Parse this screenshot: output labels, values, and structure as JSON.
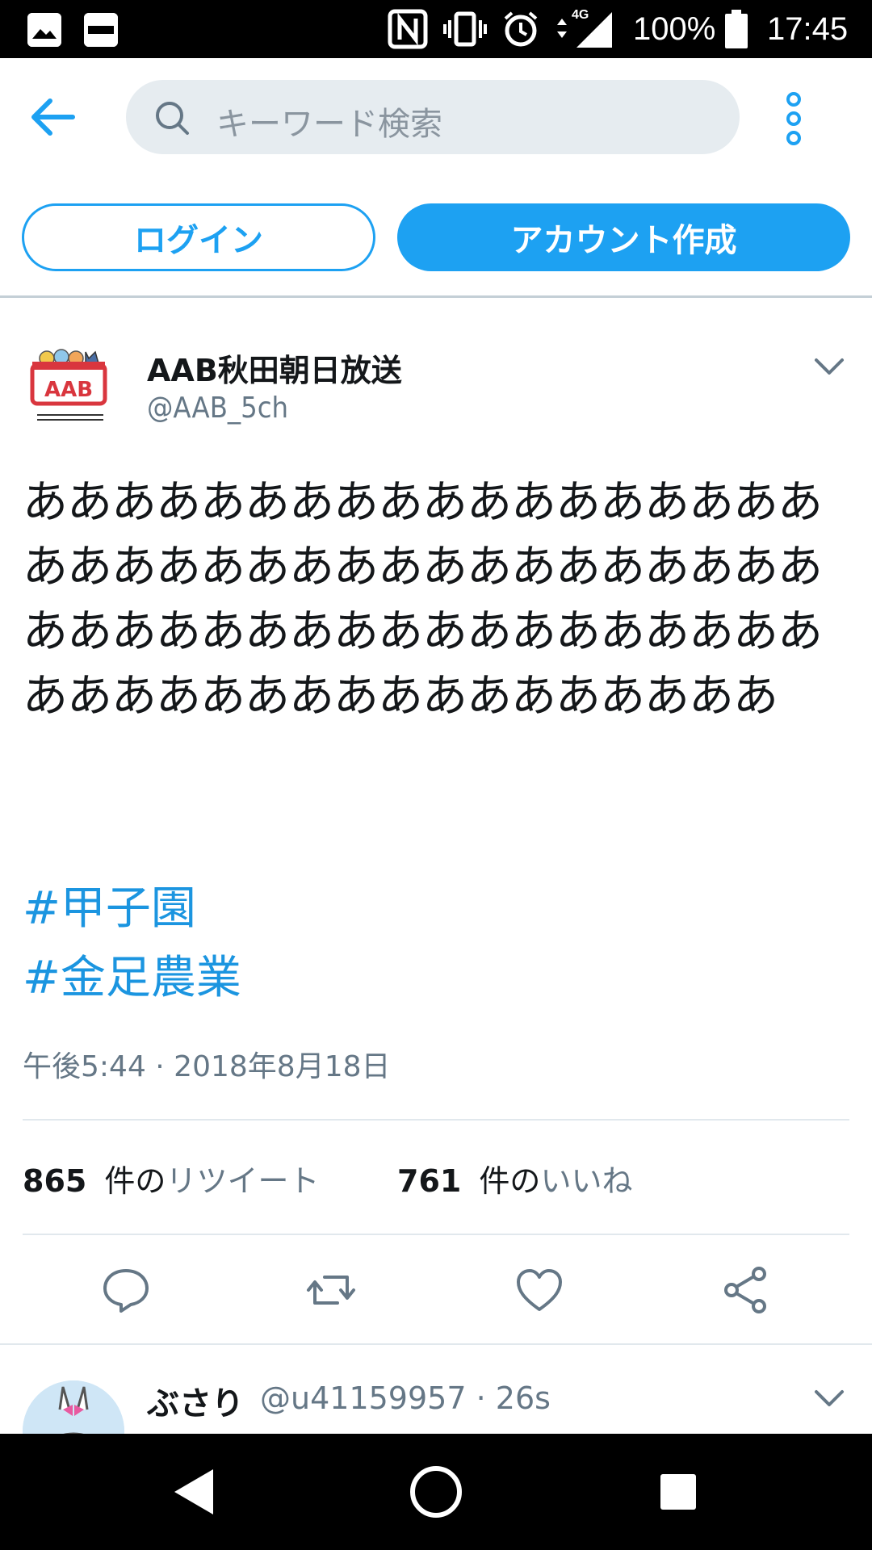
{
  "status_bar": {
    "battery": "100%",
    "time": "17:45",
    "network": "4G"
  },
  "toolbar": {
    "search_placeholder": "キーワード検索",
    "back_icon": "back-arrow-icon",
    "more_icon": "more-vert-icon"
  },
  "auth": {
    "login_label": "ログイン",
    "signup_label": "アカウント作成"
  },
  "tweet": {
    "author_name": "AAB秋田朝日放送",
    "author_handle": "@AAB_5ch",
    "text": "あああああああああああああああああああああああああああああああああああああああああああああああああああああああああああああああああああああああ",
    "hashtags": [
      "#甲子園",
      "#金足農業"
    ],
    "timestamp": "午後5:44 · 2018年8月18日",
    "retweet_count": "865",
    "retweet_label_ken": "件の",
    "retweet_label": "リツイート",
    "like_count": "761",
    "like_label_ken": "件の",
    "like_label": "いいね"
  },
  "reply": {
    "name": "ぶさり",
    "handle": "@u41159957",
    "time": "26s"
  },
  "colors": {
    "accent": "#1da1f2",
    "hashtag": "#1b95e0",
    "muted": "#657786"
  }
}
